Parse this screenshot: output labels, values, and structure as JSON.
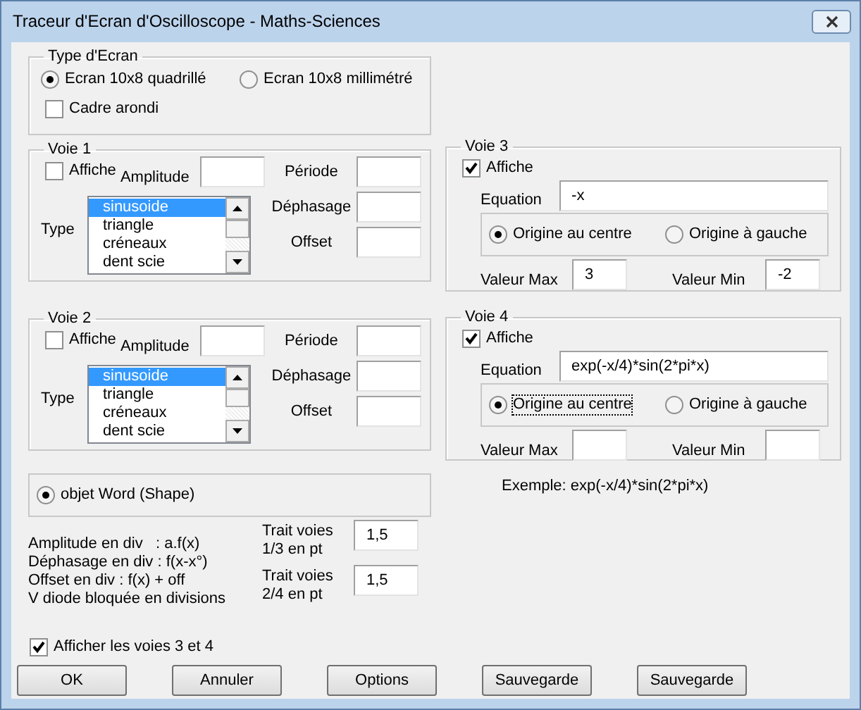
{
  "window": {
    "title": "Traceur d'Ecran d'Oscilloscope - Maths-Sciences"
  },
  "screen_type": {
    "title": "Type d'Ecran",
    "options": [
      {
        "label": "Ecran 10x8 quadrillé",
        "selected": true
      },
      {
        "label": "Ecran 10x8 millimétré",
        "selected": false
      }
    ],
    "rounded_frame": {
      "label": "Cadre arondi",
      "checked": false
    }
  },
  "channels_left": [
    {
      "title": "Voie 1",
      "show": {
        "label": "Affiche",
        "checked": false
      },
      "amplitude": {
        "label": "Amplitude"
      },
      "type_label": "Type",
      "type_list": [
        {
          "label": "sinusoide",
          "selected": true
        },
        {
          "label": "triangle",
          "selected": false
        },
        {
          "label": "créneaux",
          "selected": false
        },
        {
          "label": "dent scie",
          "selected": false
        }
      ],
      "fields": [
        {
          "label": "Période"
        },
        {
          "label": "Déphasage"
        },
        {
          "label": "Offset"
        }
      ]
    },
    {
      "title": "Voie 2",
      "show": {
        "label": "Affiche",
        "checked": false
      },
      "amplitude": {
        "label": "Amplitude"
      },
      "type_label": "Type",
      "type_list": [
        {
          "label": "sinusoide",
          "selected": true
        },
        {
          "label": "triangle",
          "selected": false
        },
        {
          "label": "créneaux",
          "selected": false
        },
        {
          "label": "dent scie",
          "selected": false
        }
      ],
      "fields": [
        {
          "label": "Période"
        },
        {
          "label": "Déphasage"
        },
        {
          "label": "Offset"
        }
      ]
    }
  ],
  "channels_right": [
    {
      "title": "Voie 3",
      "show": {
        "label": "Affiche",
        "checked": true
      },
      "equation_label": "Equation",
      "equation": "-x",
      "origin": [
        {
          "label": "Origine au centre",
          "selected": true,
          "focused": false
        },
        {
          "label": "Origine à gauche",
          "selected": false,
          "focused": false
        }
      ],
      "max": {
        "label": "Valeur Max",
        "value": "3"
      },
      "min": {
        "label": "Valeur Min",
        "value": "-2"
      }
    },
    {
      "title": "Voie 4",
      "show": {
        "label": "Affiche",
        "checked": true
      },
      "equation_label": "Equation",
      "equation": "exp(-x/4)*sin(2*pi*x)",
      "origin": [
        {
          "label": "Origine au centre",
          "selected": true,
          "focused": true
        },
        {
          "label": "Origine à gauche",
          "selected": false,
          "focused": false
        }
      ],
      "max": {
        "label": "Valeur Max"
      },
      "min": {
        "label": "Valeur Min"
      }
    }
  ],
  "example": "Exemple: exp(-x/4)*sin(2*pi*x)",
  "render": {
    "options": [
      {
        "label": "objet Word (Shape)",
        "selected": true
      }
    ]
  },
  "notes": [
    "Amplitude en div   : a.f(x)",
    "Déphasage en div : f(x-x°)",
    "Offset en div : f(x) + off",
    "V diode bloquée en divisions"
  ],
  "line_widths": [
    {
      "label": "Trait voies 1/3 en pt",
      "value": "1,5"
    },
    {
      "label": "Trait voies 2/4 en pt",
      "value": "1,5"
    }
  ],
  "show_34": {
    "label": "Afficher les voies 3 et 4",
    "checked": true
  },
  "buttons": [
    "OK",
    "Annuler",
    "Options",
    "Sauvegarde",
    "Sauvegarde"
  ]
}
